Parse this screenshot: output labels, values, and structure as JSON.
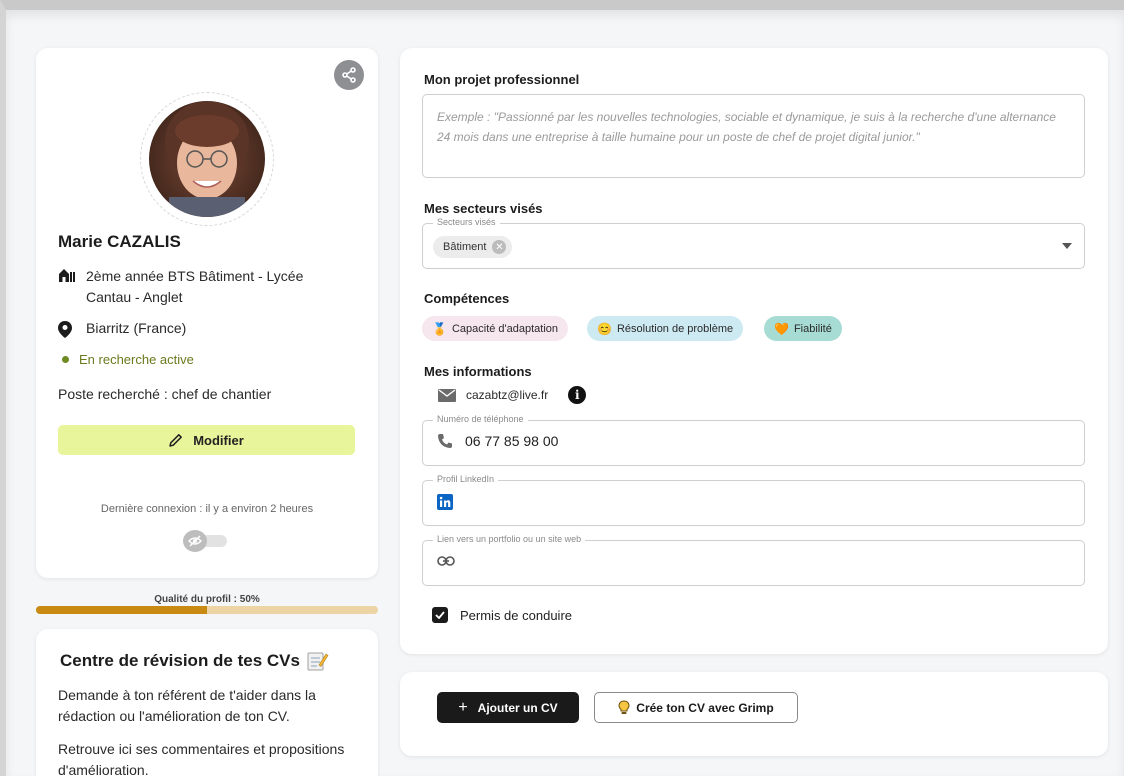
{
  "profile": {
    "name": "Marie CAZALIS",
    "school": "2ème année BTS Bâtiment - Lycée Cantau - Anglet",
    "location": "Biarritz (France)",
    "status": "En recherche active",
    "poste": "Poste recherché : chef de chantier",
    "modifier_label": "Modifier",
    "last_login": "Dernière connexion : il y a environ 2 heures",
    "visibility_toggle": "off"
  },
  "quality": {
    "label": "Qualité du profil : 50%",
    "value": 0.5
  },
  "cv_review": {
    "title": "Centre de révision de tes CVs",
    "p1": "Demande à ton référent de t'aider dans la rédaction ou l'amélioration de ton CV.",
    "p2": "Retrouve ici ses commentaires et propositions d'amélioration."
  },
  "projet": {
    "label": "Mon projet professionnel",
    "placeholder": "Exemple : \"Passionné par les nouvelles technologies, sociable et dynamique, je suis à la recherche d'une alternance 24 mois dans une entreprise à taille humaine pour un poste de chef de projet digital junior.\""
  },
  "secteurs": {
    "label": "Mes secteurs visés",
    "field_legend": "Secteurs visés",
    "selected": [
      "Bâtiment"
    ]
  },
  "competences": {
    "label": "Compétences",
    "items": [
      {
        "label": "Capacité d'adaptation",
        "emoji": "🏅",
        "color": "#f6e6ee"
      },
      {
        "label": "Résolution de problème",
        "emoji": "😊",
        "color": "#cdeaf3"
      },
      {
        "label": "Fiabilité",
        "emoji": "🧡",
        "color": "#a6dcd4"
      }
    ]
  },
  "informations": {
    "label": "Mes informations",
    "email": "cazabtz@live.fr",
    "phone_legend": "Numéro de téléphone",
    "phone": "06 77 85 98 00",
    "linkedin_legend": "Profil LinkedIn",
    "linkedin_value": "",
    "portfolio_legend": "Lien vers un portfolio ou un site web",
    "portfolio_value": "",
    "permis_label": "Permis de conduire",
    "permis_checked": true
  },
  "cv_actions": {
    "add_label": "Ajouter un CV",
    "grimp_label": "Crée ton CV avec Grimp"
  },
  "colors": {
    "accent_yellow": "#e8f59a",
    "quality_fill": "#c88a12",
    "quality_track": "#ecd4a4",
    "status_green": "#6e8a24"
  }
}
